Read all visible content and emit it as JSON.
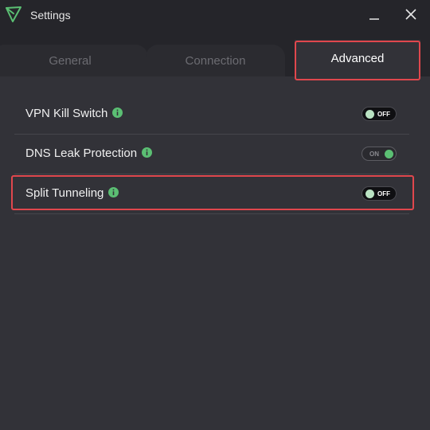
{
  "window": {
    "title": "Settings",
    "logo_icon": "protonvpn-logo-icon",
    "minimize_icon": "minimize-icon",
    "close_icon": "close-icon"
  },
  "tabs": [
    {
      "label": "General",
      "active": false
    },
    {
      "label": "Connection",
      "active": false
    },
    {
      "label": "Advanced",
      "active": true,
      "highlighted": true
    }
  ],
  "settings": [
    {
      "label": "VPN Kill Switch",
      "info_icon": "info-icon",
      "toggle_text": "OFF",
      "enabled": false
    },
    {
      "label": "DNS Leak Protection",
      "info_icon": "info-icon",
      "toggle_text": "ON",
      "enabled": true
    },
    {
      "label": "Split Tunneling",
      "info_icon": "info-icon",
      "toggle_text": "OFF",
      "enabled": false,
      "highlighted": true
    }
  ],
  "colors": {
    "background": "#323238",
    "titlebar": "#25252a",
    "accent_green": "#5bbf73",
    "highlight_red": "#e0474d"
  }
}
